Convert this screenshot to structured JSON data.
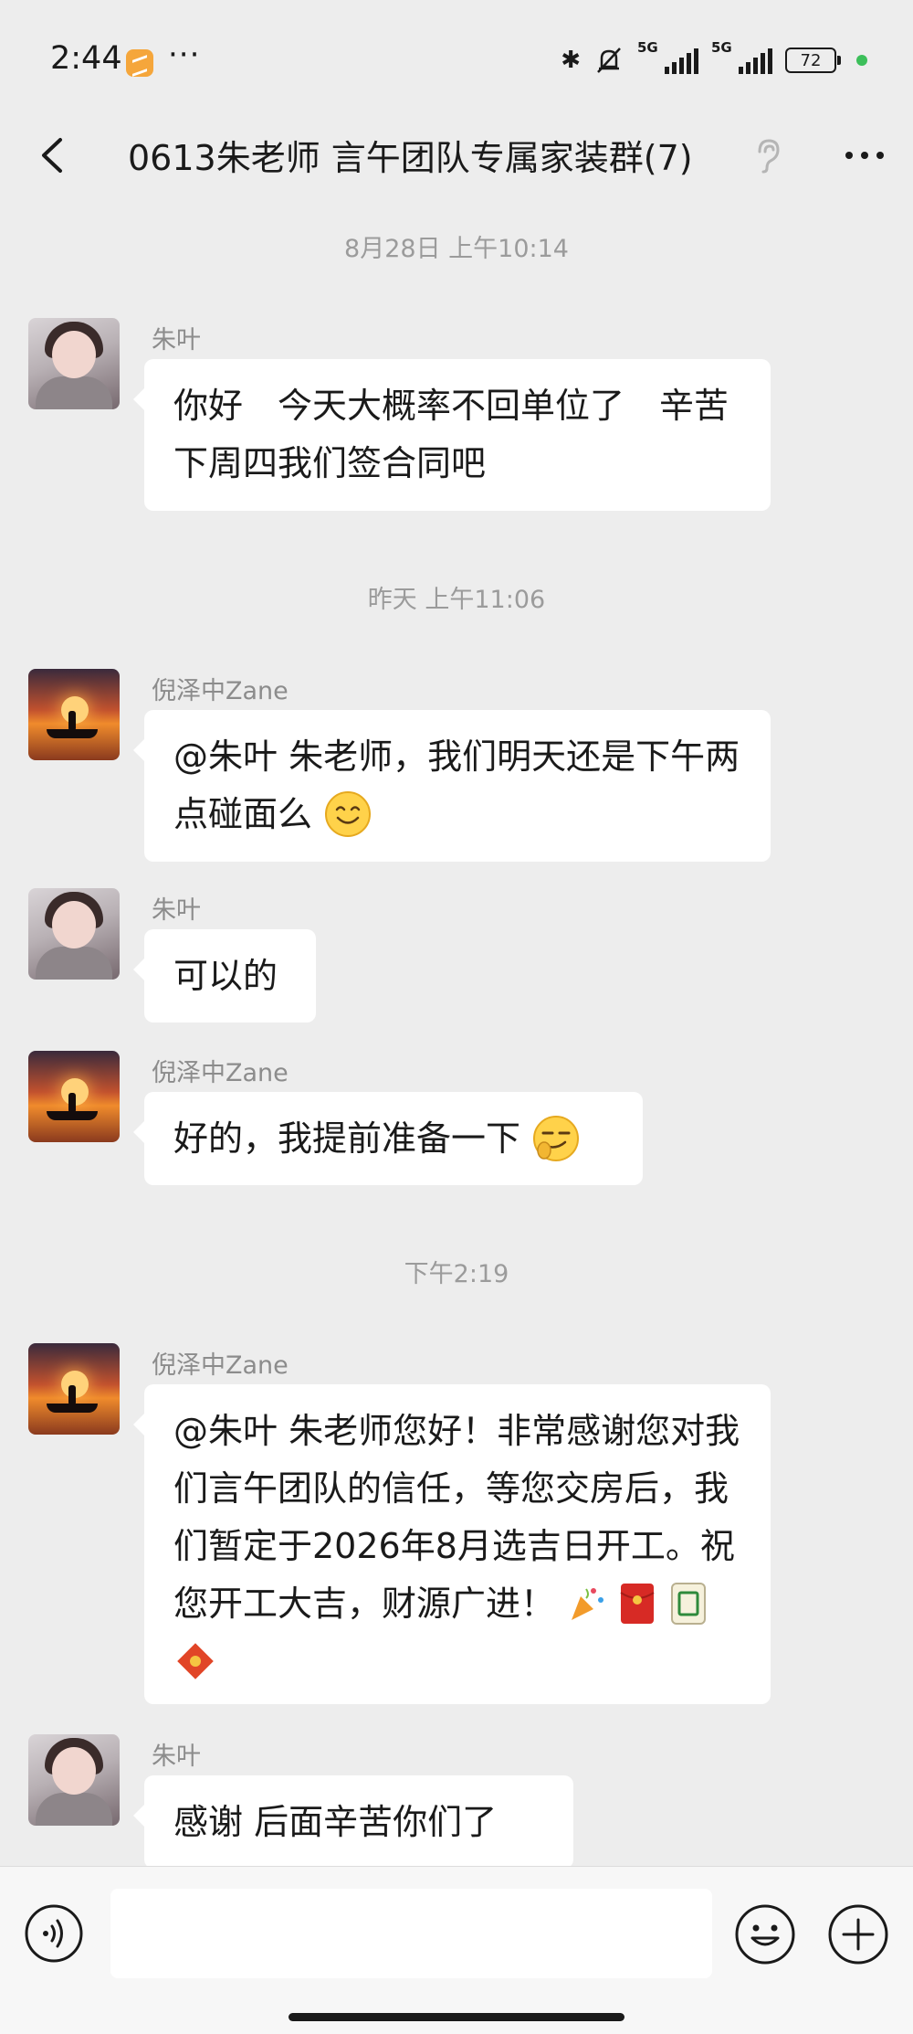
{
  "status_bar": {
    "time": "2:44",
    "more": "···",
    "network_1": "5G",
    "network_2": "5G",
    "battery": "72"
  },
  "nav": {
    "title": "0613朱老师 言午团队专属家装群(7)"
  },
  "messages": [
    {
      "type": "timestamp",
      "text": "8月28日 上午10:14"
    },
    {
      "type": "message",
      "sender": "朱叶",
      "text": "你好　今天大概率不回单位了　辛苦下周四我们签合同吧"
    },
    {
      "type": "timestamp",
      "text": "昨天 上午11:06"
    },
    {
      "type": "message",
      "sender": "倪泽中Zane",
      "text": "@朱叶  朱老师，我们明天还是下午两点碰面么"
    },
    {
      "type": "message",
      "sender": "朱叶",
      "text": "可以的"
    },
    {
      "type": "message",
      "sender": "倪泽中Zane",
      "text": "好的，我提前准备一下"
    },
    {
      "type": "timestamp",
      "text": "下午2:19"
    },
    {
      "type": "message",
      "sender": "倪泽中Zane",
      "text": "@朱叶  朱老师您好！非常感谢您对我们言午团队的信任，等您交房后，我们暂定于2026年8月选吉日开工。祝您开工大吉，财源广进！"
    },
    {
      "type": "message",
      "sender": "朱叶",
      "text": "感谢  后面辛苦你们了"
    }
  ],
  "colors": {
    "background": "#ededed",
    "bubble": "#ffffff",
    "timestamp": "#9b9b9b"
  },
  "icons": [
    "back-arrow-icon",
    "ear-icon",
    "more-icon",
    "voice-icon",
    "emoji-icon",
    "plus-icon"
  ]
}
